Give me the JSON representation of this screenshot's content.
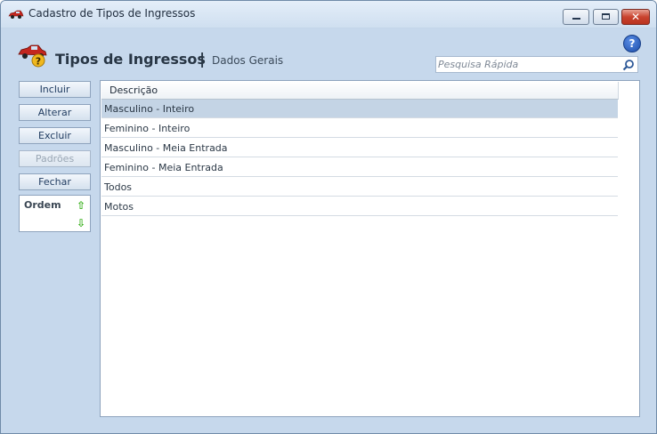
{
  "window": {
    "title": "Cadastro de Tipos de Ingressos",
    "controls": {
      "close": "✕"
    }
  },
  "header": {
    "title": "Tipos de Ingressos",
    "separator": "|",
    "subtitle": "Dados Gerais",
    "help_glyph": "?"
  },
  "search": {
    "placeholder": "Pesquisa Rápida",
    "value": ""
  },
  "actions": [
    {
      "label": "Incluir",
      "enabled": true
    },
    {
      "label": "Alterar",
      "enabled": true
    },
    {
      "label": "Excluir",
      "enabled": true
    },
    {
      "label": "Padrões",
      "enabled": false
    },
    {
      "label": "Fechar",
      "enabled": true
    }
  ],
  "order": {
    "label": "Ordem",
    "up": "⇧",
    "down": "⇩"
  },
  "grid": {
    "columns": [
      "Descrição"
    ],
    "rows": [
      {
        "descricao": "Masculino - Inteiro",
        "selected": true
      },
      {
        "descricao": "Feminino - Inteiro",
        "selected": false
      },
      {
        "descricao": "Masculino - Meia Entrada",
        "selected": false
      },
      {
        "descricao": "Feminino - Meia Entrada",
        "selected": false
      },
      {
        "descricao": "Todos",
        "selected": false
      },
      {
        "descricao": "Motos",
        "selected": false
      }
    ]
  },
  "icons": {
    "app": "car-icon",
    "header": "car-help-icon",
    "help": "help-icon",
    "search": "magnifier-icon"
  },
  "colors": {
    "window_bg": "#c6d8ec",
    "selection": "#c4d4e5",
    "close_button": "#c9432f",
    "order_arrows": "#3bb01f"
  }
}
